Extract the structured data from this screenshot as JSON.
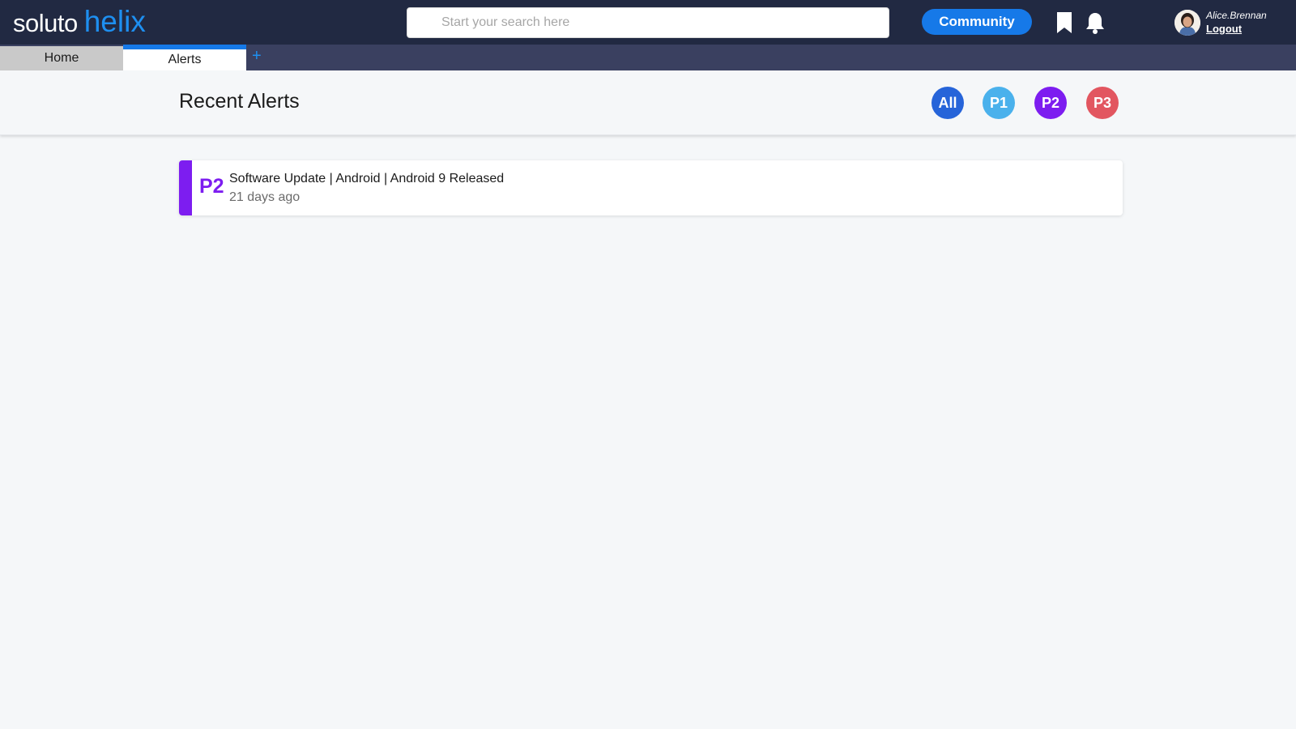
{
  "header": {
    "logo": {
      "part1": "soluto",
      "part2": "helix"
    },
    "search": {
      "placeholder": "Start your search here",
      "value": ""
    },
    "community_label": "Community",
    "user": {
      "name": "Alice.Brennan",
      "logout_label": "Logout"
    }
  },
  "tabs": [
    {
      "label": "Home",
      "active": false
    },
    {
      "label": "Alerts",
      "active": true
    }
  ],
  "tab_add_label": "+",
  "page": {
    "title": "Recent Alerts",
    "filters": [
      {
        "label": "All",
        "color": "#2664d9"
      },
      {
        "label": "P1",
        "color": "#4ab1ec"
      },
      {
        "label": "P2",
        "color": "#7d1df0"
      },
      {
        "label": "P3",
        "color": "#e25660"
      }
    ]
  },
  "alerts": [
    {
      "priority": "P2",
      "color": "#7d1df0",
      "title": "Software Update | Android | Android 9 Released",
      "time": "21 days ago"
    }
  ],
  "colors": {
    "topbar": "#212942",
    "accent": "#1679e8",
    "helix_blue": "#1e8ff0"
  }
}
